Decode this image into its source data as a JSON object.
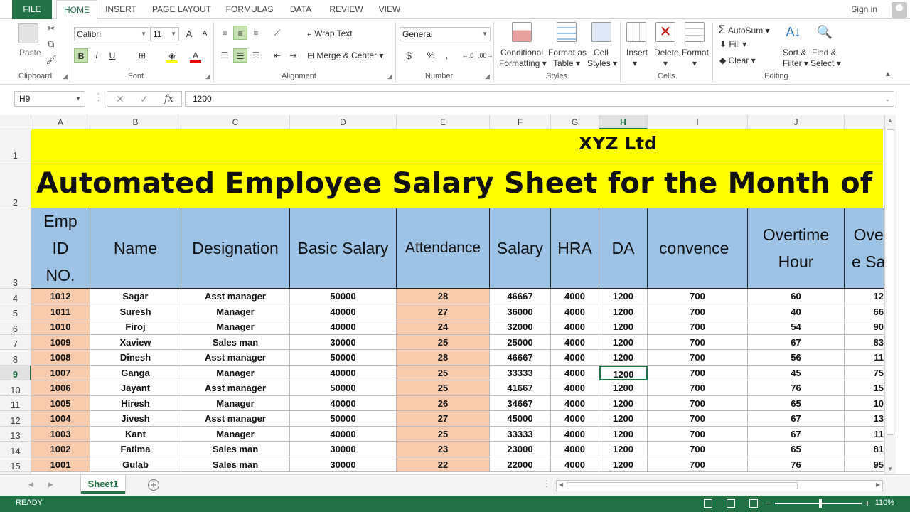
{
  "ribbon_tabs": [
    "FILE",
    "HOME",
    "INSERT",
    "PAGE LAYOUT",
    "FORMULAS",
    "DATA",
    "REVIEW",
    "VIEW"
  ],
  "signin": "Sign in",
  "ribbon": {
    "clipboard": {
      "paste": "Paste",
      "label": "Clipboard"
    },
    "font": {
      "name": "Calibri",
      "size": "11",
      "label": "Font",
      "bold": "B",
      "italic": "I",
      "underline": "U",
      "grow": "A",
      "shrink": "A"
    },
    "alignment": {
      "wrap_text": "Wrap Text",
      "merge_center": "Merge & Center",
      "label": "Alignment"
    },
    "number": {
      "format": "General",
      "currency": "$",
      "percent": "%",
      "comma": ",",
      "label": "Number"
    },
    "styles": {
      "conditional_1": "Conditional",
      "conditional_2": "Formatting",
      "format_table_1": "Format as",
      "format_table_2": "Table",
      "cell_styles_1": "Cell",
      "cell_styles_2": "Styles",
      "label": "Styles"
    },
    "cells": {
      "insert": "Insert",
      "delete": "Delete",
      "format": "Format",
      "label": "Cells"
    },
    "editing": {
      "autosum": "AutoSum",
      "fill": "Fill",
      "clear": "Clear",
      "sort_1": "Sort &",
      "sort_2": "Filter",
      "find_1": "Find &",
      "find_2": "Select",
      "label": "Editing"
    },
    "colors": {
      "accent": "#217346",
      "font_color_bar": "#ff0000",
      "fill_color_bar": "#ffff00"
    }
  },
  "formula_bar": {
    "name_box": "H9",
    "formula": "1200",
    "fx": "fx"
  },
  "columns": [
    "A",
    "B",
    "C",
    "D",
    "E",
    "F",
    "G",
    "H",
    "I",
    "J"
  ],
  "selected_column": "H",
  "rows": [
    "1",
    "2",
    "3",
    "4",
    "5",
    "6",
    "7",
    "8",
    "9",
    "10",
    "11",
    "12",
    "13",
    "14",
    "15"
  ],
  "selected_row": "9",
  "sheet": {
    "company": "XYZ Ltd",
    "title": "Automated Employee Salary Sheet for the Month of ……",
    "headers": {
      "emp_id": [
        "Emp",
        "ID",
        "NO."
      ],
      "name": "Name",
      "designation": "Designation",
      "basic_salary": "Basic Salary",
      "attendance": "Attendance",
      "salary": "Salary",
      "hra": "HRA",
      "da": "DA",
      "convence": "convence",
      "overtime_hour": [
        "Overtime",
        "Hour"
      ],
      "overtime_salary": [
        "Ove",
        "e Sa"
      ]
    },
    "data": [
      [
        "1012",
        "Sagar",
        "Asst manager",
        "50000",
        "28",
        "46667",
        "4000",
        "1200",
        "700",
        "60",
        "12"
      ],
      [
        "1011",
        "Suresh",
        "Manager",
        "40000",
        "27",
        "36000",
        "4000",
        "1200",
        "700",
        "40",
        "66"
      ],
      [
        "1010",
        "Firoj",
        "Manager",
        "40000",
        "24",
        "32000",
        "4000",
        "1200",
        "700",
        "54",
        "90"
      ],
      [
        "1009",
        "Xaview",
        "Sales man",
        "30000",
        "25",
        "25000",
        "4000",
        "1200",
        "700",
        "67",
        "83"
      ],
      [
        "1008",
        "Dinesh",
        "Asst manager",
        "50000",
        "28",
        "46667",
        "4000",
        "1200",
        "700",
        "56",
        "11"
      ],
      [
        "1007",
        "Ganga",
        "Manager",
        "40000",
        "25",
        "33333",
        "4000",
        "1200",
        "700",
        "45",
        "75"
      ],
      [
        "1006",
        "Jayant",
        "Asst manager",
        "50000",
        "25",
        "41667",
        "4000",
        "1200",
        "700",
        "76",
        "15"
      ],
      [
        "1005",
        "Hiresh",
        "Manager",
        "40000",
        "26",
        "34667",
        "4000",
        "1200",
        "700",
        "65",
        "10"
      ],
      [
        "1004",
        "Jivesh",
        "Asst manager",
        "50000",
        "27",
        "45000",
        "4000",
        "1200",
        "700",
        "67",
        "13"
      ],
      [
        "1003",
        "Kant",
        "Manager",
        "40000",
        "25",
        "33333",
        "4000",
        "1200",
        "700",
        "67",
        "11"
      ],
      [
        "1002",
        "Fatima",
        "Sales man",
        "30000",
        "23",
        "23000",
        "4000",
        "1200",
        "700",
        "65",
        "81"
      ],
      [
        "1001",
        "Gulab",
        "Sales man",
        "30000",
        "22",
        "22000",
        "4000",
        "1200",
        "700",
        "76",
        "95"
      ]
    ]
  },
  "sheet_tabs": [
    "Sheet1"
  ],
  "add_sheet": "+",
  "status": {
    "ready": "READY",
    "zoom": "110%"
  }
}
